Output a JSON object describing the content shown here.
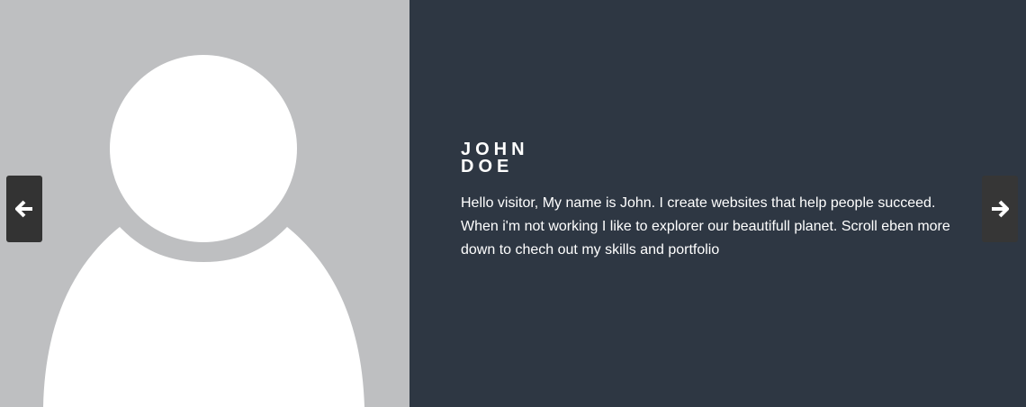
{
  "profile": {
    "first_name": "JOHN",
    "last_name": "DOE",
    "bio": "Hello visitor, My name is John. I create websites that help people succeed. When i'm not working I like to explorer our beautifull planet. Scroll eben more down to chech out my skills and portfolio"
  },
  "carousel": {
    "prev_icon": "arrow-left-icon",
    "next_icon": "arrow-right-icon"
  },
  "colors": {
    "photo_background": "#bebfc1",
    "info_background": "#2e3743",
    "nav_button": "#333333",
    "avatar": "#ffffff"
  }
}
